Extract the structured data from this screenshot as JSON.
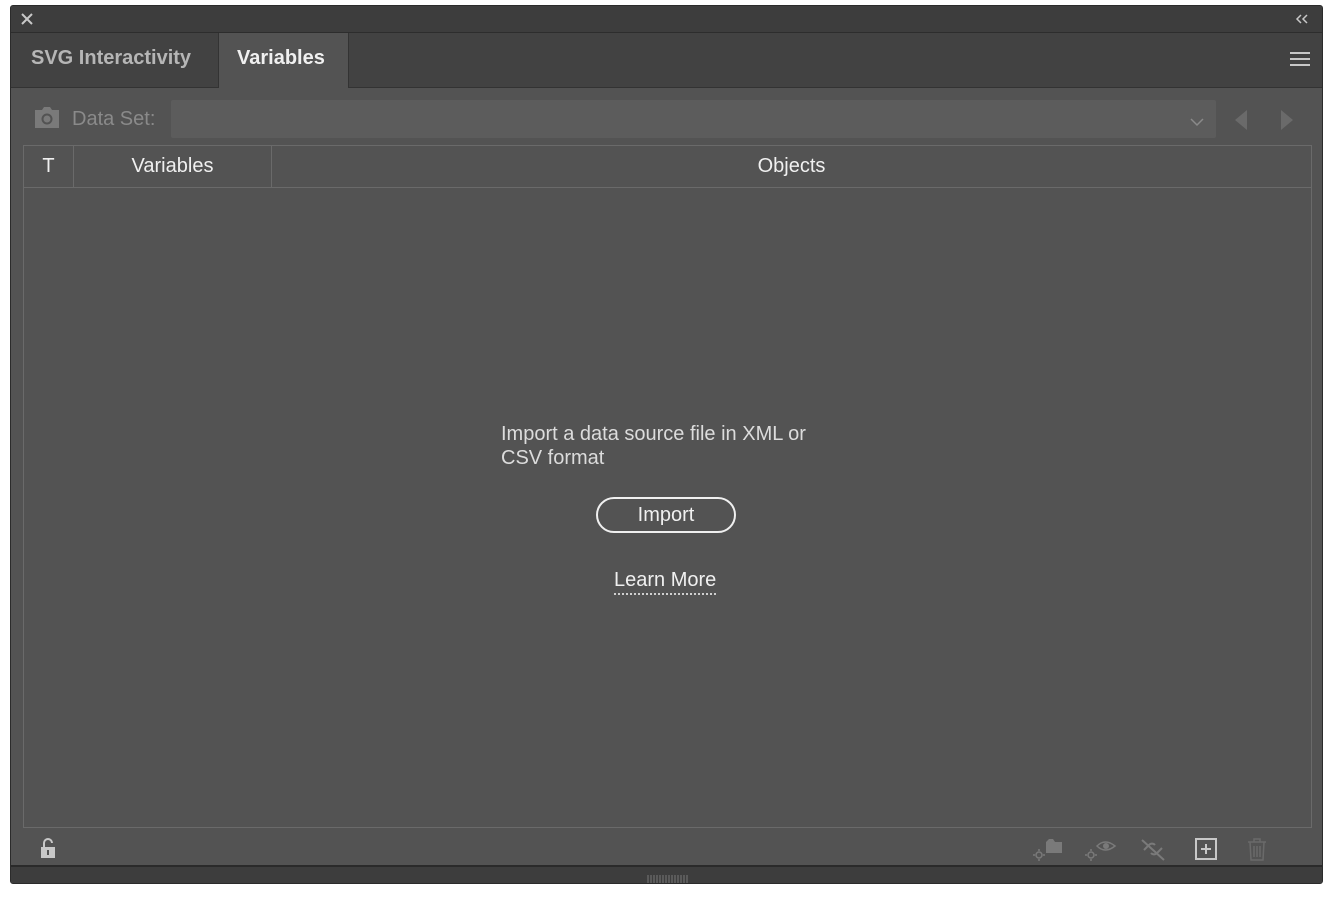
{
  "tabs": [
    {
      "label": "SVG Interactivity",
      "active": false
    },
    {
      "label": "Variables",
      "active": true
    }
  ],
  "dataset": {
    "label": "Data Set:",
    "value": ""
  },
  "table": {
    "columns": [
      "T",
      "Variables",
      "Objects"
    ]
  },
  "empty_state": {
    "message": "Import a data source file in XML or CSV format",
    "import_label": "Import",
    "learn_more_label": "Learn More"
  },
  "icons": {
    "close": "close-icon",
    "collapse": "double-chevron-left-icon",
    "menu": "hamburger-menu-icon",
    "camera": "camera-icon",
    "prev": "triangle-left-icon",
    "next": "triangle-right-icon",
    "lock": "unlock-icon",
    "capture": "capture-data-set-icon",
    "visibility": "make-visibility-dynamic-icon",
    "unbind": "unbind-variable-icon",
    "new": "new-variable-icon",
    "trash": "trash-icon"
  },
  "colors": {
    "panel_bg": "#535353",
    "tabbar_bg": "#424242",
    "text": "#f0f0f0"
  }
}
